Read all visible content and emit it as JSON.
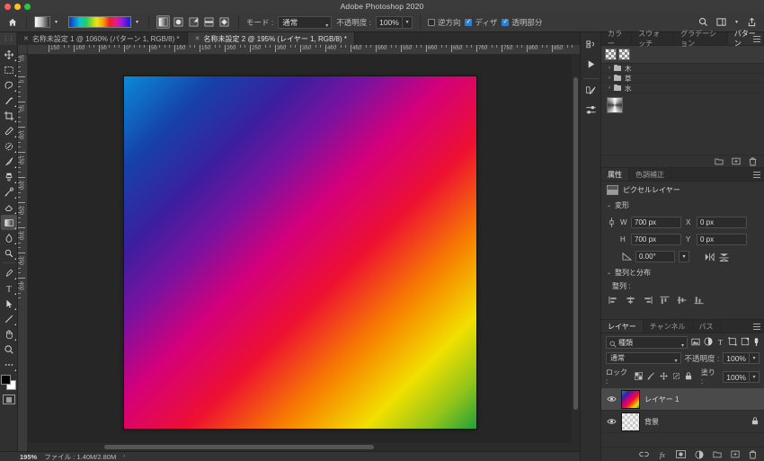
{
  "window": {
    "title": "Adobe Photoshop 2020",
    "traffic_lights": [
      "close",
      "minimize",
      "maximize"
    ]
  },
  "options_bar": {
    "home_icon": "home-icon",
    "tool_preset_label": "gradient-tool-preset",
    "gradient_preset_label": "rainbow-spectrum-gradient",
    "gradient_types": [
      {
        "name": "linear-gradient",
        "active": true
      },
      {
        "name": "radial-gradient",
        "active": false
      },
      {
        "name": "angle-gradient",
        "active": false
      },
      {
        "name": "reflected-gradient",
        "active": false
      },
      {
        "name": "diamond-gradient",
        "active": false
      }
    ],
    "mode_label": "モード :",
    "mode_value": "通常",
    "opacity_label": "不透明度 :",
    "opacity_value": "100%",
    "reverse_label": "逆方向",
    "reverse_checked": false,
    "dither_label": "ディザ",
    "dither_checked": true,
    "transparency_label": "透明部分",
    "transparency_checked": true,
    "search_icon": "search-icon",
    "workspace_icon": "workspace-icon",
    "share_icon": "share-icon"
  },
  "document_tabs": [
    {
      "label": "名称未設定 1 @ 1060% (パターン 1, RGB/8) *",
      "active": false
    },
    {
      "label": "名称未設定 2 @ 195% (レイヤー 1, RGB/8) *",
      "active": true
    }
  ],
  "toolbar": {
    "tools": [
      {
        "name": "move-tool",
        "selected": false
      },
      {
        "name": "rectangular-marquee-tool",
        "selected": false
      },
      {
        "name": "lasso-tool",
        "selected": false
      },
      {
        "name": "magic-wand-tool",
        "selected": false
      },
      {
        "name": "crop-tool",
        "selected": false
      },
      {
        "name": "eyedropper-tool",
        "selected": false
      },
      {
        "name": "spot-healing-brush-tool",
        "selected": false
      },
      {
        "name": "brush-tool",
        "selected": false
      },
      {
        "name": "clone-stamp-tool",
        "selected": false
      },
      {
        "name": "history-brush-tool",
        "selected": false
      },
      {
        "name": "eraser-tool",
        "selected": false
      },
      {
        "name": "gradient-tool",
        "selected": true
      },
      {
        "name": "blur-tool",
        "selected": false
      },
      {
        "name": "dodge-tool",
        "selected": false
      },
      {
        "name": "pen-tool",
        "selected": false
      },
      {
        "name": "type-tool",
        "selected": false
      },
      {
        "name": "path-selection-tool",
        "selected": false
      },
      {
        "name": "line-shape-tool",
        "selected": false
      },
      {
        "name": "hand-tool",
        "selected": false
      },
      {
        "name": "zoom-tool",
        "selected": false
      },
      {
        "name": "edit-toolbar-tool",
        "selected": false
      }
    ],
    "foreground_color": "#000000",
    "background_color": "#ffffff",
    "quick_mask_label": "quick-mask-mode"
  },
  "rulers": {
    "unit_hint": "px",
    "h_labels": [
      "150",
      "100",
      "50",
      "0",
      "50",
      "100",
      "150",
      "200",
      "250",
      "300",
      "350",
      "400",
      "450",
      "500",
      "550",
      "600",
      "650",
      "700",
      "750",
      "800",
      "850"
    ],
    "v_labels": [
      "50",
      "0",
      "50",
      "100",
      "150",
      "200",
      "250",
      "300",
      "350",
      "400"
    ]
  },
  "canvas": {
    "artboard_name": "gradient-artboard",
    "gradient_stops": [
      "#0a8ad8",
      "#1642a8",
      "#3b1f9e",
      "#7a12a0",
      "#d4007a",
      "#ee1030",
      "#f77f00",
      "#f2e000",
      "#8fc41a",
      "#21a038"
    ],
    "gradient_angle": "135deg"
  },
  "status_bar": {
    "zoom": "195%",
    "doc_label": "ファイル : 1.40M/2.80M",
    "expand_arrow": "›"
  },
  "dock_rail": {
    "buttons": [
      "history-panel-icon",
      "actions-panel-icon",
      "brush-settings-icon",
      "adjustments-icon"
    ]
  },
  "pattern_panel": {
    "tabs": [
      {
        "label": "カラー",
        "active": false
      },
      {
        "label": "スウォッチ",
        "active": false
      },
      {
        "label": "グラデーション",
        "active": false
      },
      {
        "label": "パターン",
        "active": true
      }
    ],
    "menu_icon": "panel-menu-icon",
    "recent_swatches": [
      "checker-pattern-1",
      "checker-pattern-2"
    ],
    "groups": [
      {
        "label": "木",
        "expanded": false
      },
      {
        "label": "草",
        "expanded": false
      },
      {
        "label": "水",
        "expanded": false
      }
    ],
    "loose_pattern": "radial-gray-pattern",
    "footer_icons": [
      "new-group-icon",
      "new-pattern-icon",
      "delete-icon"
    ]
  },
  "properties_panel": {
    "tabs": [
      {
        "label": "属性",
        "active": true
      },
      {
        "label": "色調補正",
        "active": false
      }
    ],
    "menu_icon": "panel-menu-icon",
    "layer_type": "ピクセルレイヤー",
    "layer_type_icon": "pixel-layer-icon",
    "transform": {
      "section_label": "変形",
      "link_icon": "link-width-height-icon",
      "w_label": "W",
      "w_value": "700 px",
      "x_label": "X",
      "x_value": "0 px",
      "h_label": "H",
      "h_value": "700 px",
      "y_label": "Y",
      "y_value": "0 px",
      "angle_icon": "angle-icon",
      "angle_value": "0.00°",
      "flip_h_icon": "flip-horizontal-icon",
      "flip_v_icon": "flip-vertical-icon"
    },
    "align": {
      "section_label": "整列と分布",
      "align_label": "整列 :",
      "buttons": [
        "align-left-icon",
        "align-center-h-icon",
        "align-right-icon",
        "align-top-icon",
        "align-center-v-icon",
        "align-bottom-icon"
      ]
    }
  },
  "layers_panel": {
    "tabs": [
      {
        "label": "レイヤー",
        "active": true
      },
      {
        "label": "チャンネル",
        "active": false
      },
      {
        "label": "パス",
        "active": false
      }
    ],
    "menu_icon": "panel-menu-icon",
    "filter_value": "種類",
    "filter_icons": [
      "filter-pixel-icon",
      "filter-adjustment-icon",
      "filter-type-icon",
      "filter-shape-icon",
      "filter-smart-icon"
    ],
    "filter_toggle": "filter-toggle-icon",
    "blend_mode": "通常",
    "opacity_label": "不透明度 :",
    "opacity_value": "100%",
    "lock_label": "ロック :",
    "lock_icons": [
      "lock-transparent-icon",
      "lock-image-icon",
      "lock-position-icon",
      "lock-nesting-icon",
      "lock-all-icon"
    ],
    "fill_label": "塗り :",
    "fill_value": "100%",
    "layers": [
      {
        "name": "レイヤー 1",
        "visible": true,
        "selected": true,
        "thumb": "gradient",
        "locked": false
      },
      {
        "name": "背景",
        "visible": true,
        "selected": false,
        "thumb": "checker",
        "locked": true
      }
    ],
    "footer_icons": [
      "link-layers-icon",
      "layer-style-icon",
      "layer-mask-icon",
      "adjustment-layer-icon",
      "new-group-icon",
      "new-layer-icon",
      "delete-layer-icon"
    ]
  }
}
